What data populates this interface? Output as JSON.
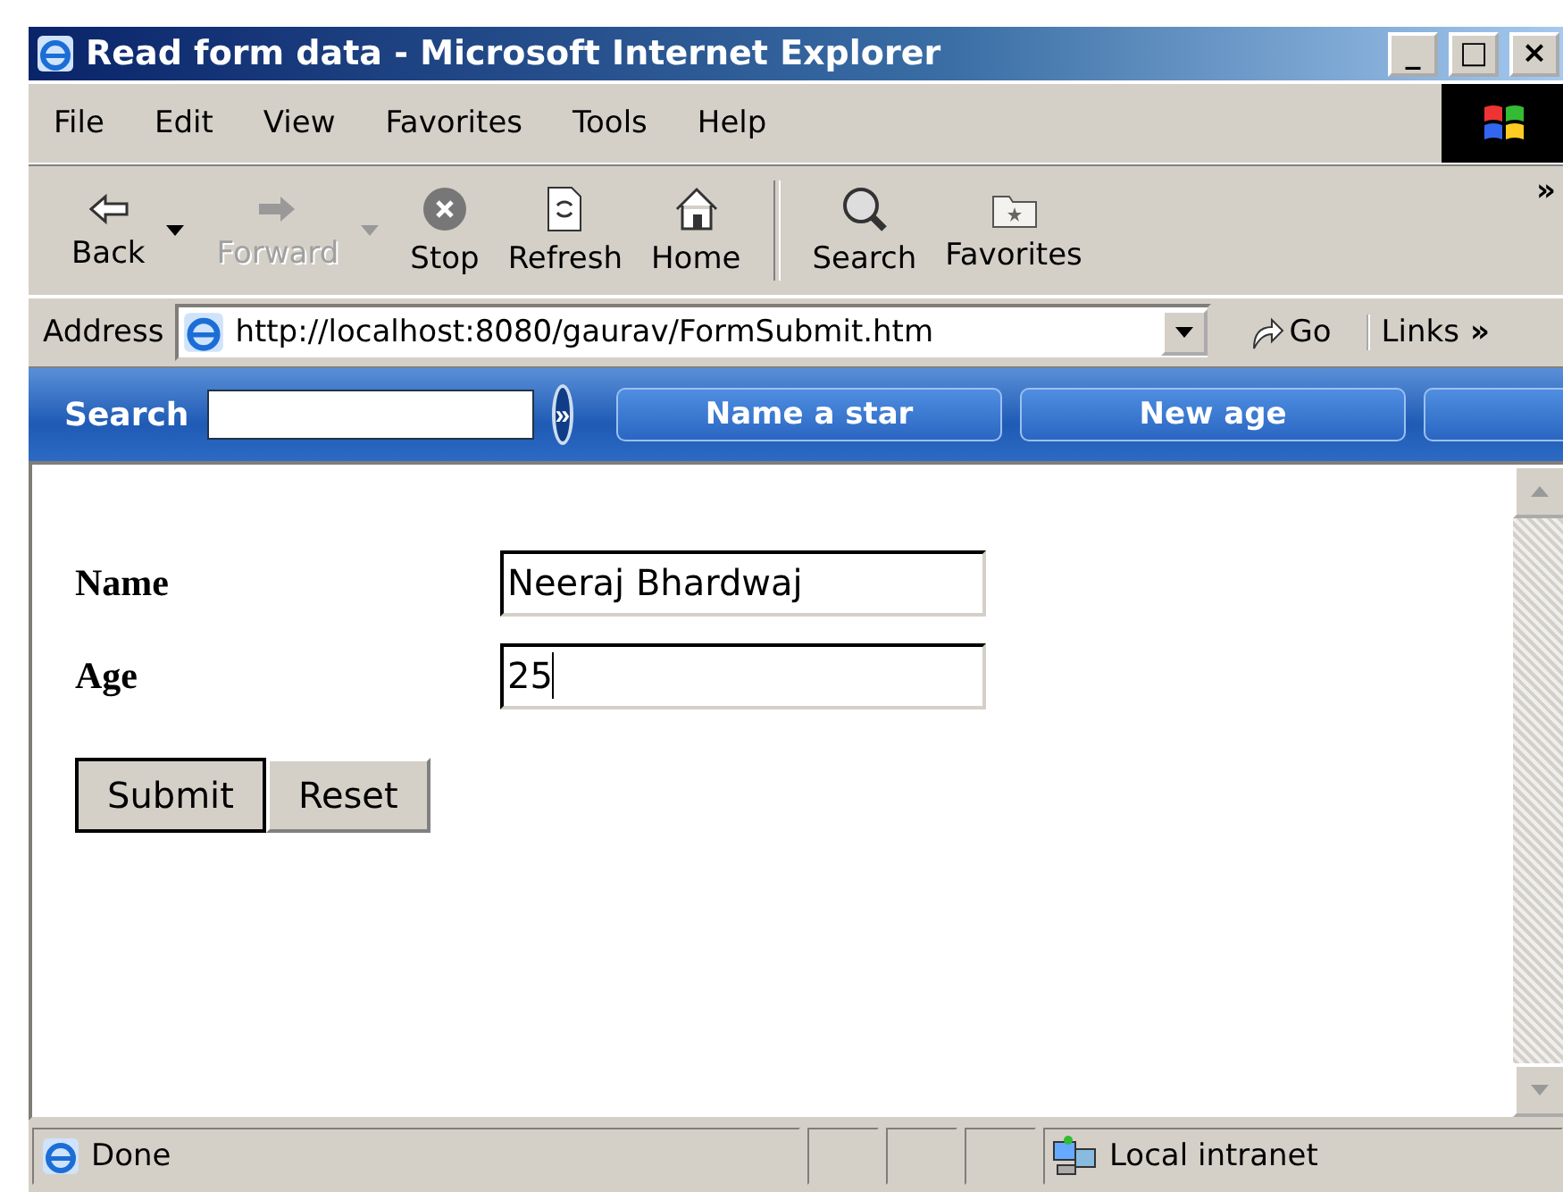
{
  "window": {
    "title": "Read form data - Microsoft Internet Explorer",
    "controls": [
      "_",
      "□",
      "×"
    ]
  },
  "menu": [
    "File",
    "Edit",
    "View",
    "Favorites",
    "Tools",
    "Help"
  ],
  "toolbar": {
    "items": [
      {
        "kind": "back",
        "label": "Back",
        "disabled": false,
        "dropdown": true
      },
      {
        "kind": "forward",
        "label": "Forward",
        "disabled": true,
        "dropdown": true
      },
      {
        "kind": "stop",
        "label": "Stop",
        "disabled": false,
        "dropdown": false
      },
      {
        "kind": "refresh",
        "label": "Refresh",
        "disabled": false,
        "dropdown": false
      },
      {
        "kind": "home",
        "label": "Home",
        "disabled": false,
        "dropdown": false
      },
      {
        "kind": "separator"
      },
      {
        "kind": "search",
        "label": "Search",
        "disabled": false,
        "dropdown": false
      },
      {
        "kind": "favorites",
        "label": "Favorites",
        "disabled": false,
        "dropdown": false
      }
    ],
    "more": "»"
  },
  "address": {
    "label": "Address",
    "url": "http://localhost:8080/gaurav/FormSubmit.htm",
    "go": "Go",
    "links": "Links",
    "links_more": "»"
  },
  "search_bar": {
    "label": "Search",
    "go": "»",
    "buttons": [
      {
        "kind": "link",
        "label": "Name a star"
      },
      {
        "kind": "link",
        "label": "New age"
      },
      {
        "kind": "blank"
      }
    ]
  },
  "form": {
    "fields": [
      {
        "label": "Name",
        "value": "Neeraj Bhardwaj",
        "focused": false
      },
      {
        "label": "Age",
        "value": "25",
        "focused": true
      }
    ],
    "buttons": [
      {
        "label": "Submit",
        "default": true
      },
      {
        "label": "Reset",
        "default": false
      }
    ]
  },
  "status_bar": {
    "text": "Done",
    "zone": "Local intranet"
  }
}
